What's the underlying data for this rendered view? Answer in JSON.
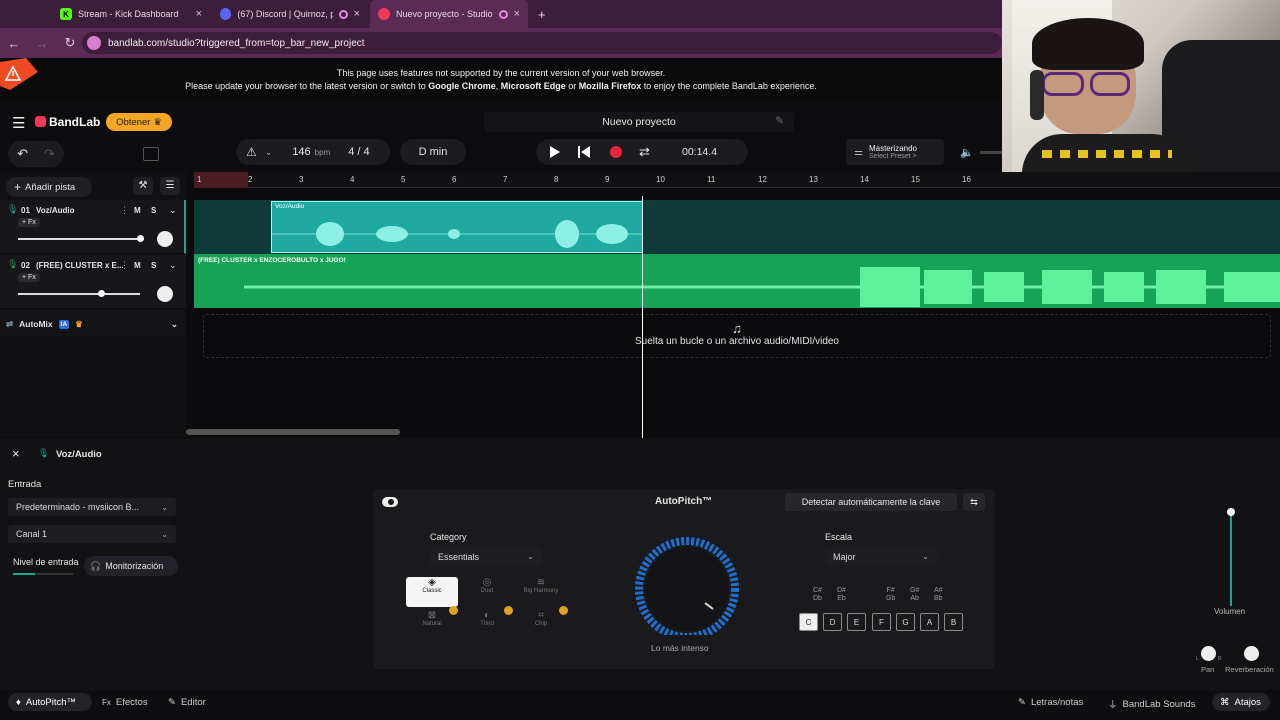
{
  "browser": {
    "tabs": [
      {
        "title": "Stream - Kick Dashboard",
        "favicon": "K",
        "color": "#53fc18"
      },
      {
        "title": "(67) Discord | Quirnoz, p(",
        "favicon": "67",
        "color": "#5865f2"
      },
      {
        "title": "Nuevo proyecto - Studio",
        "favicon": "",
        "color": "#f2385a"
      }
    ],
    "new_tab": "+",
    "url": "bandlab.com/studio?triggered_from=top_bar_new_project"
  },
  "warning": {
    "line1": "This page uses features not supported by the current version of your web browser.",
    "line2_pre": "Please update your browser to the latest version or switch to ",
    "chrome": "Google Chrome",
    "comma": ", ",
    "edge": "Microsoft Edge",
    "or": " or ",
    "firefox": "Mozilla Firefox",
    "line2_post": " to enjoy the complete BandLab experience."
  },
  "header": {
    "logo": "BandLab",
    "get_button": "Obtener",
    "project_name": "Nuevo proyecto"
  },
  "toolbar": {
    "bpm_value": "146",
    "bpm_unit": "bpm",
    "time_sig": "4 / 4",
    "key": "D min",
    "time": "00:14.4",
    "mastering_title": "Masterizando",
    "mastering_sub": "Select Preset >"
  },
  "ruler": {
    "numbers": [
      "1",
      "2",
      "3",
      "4",
      "5",
      "6",
      "7",
      "8",
      "9",
      "10",
      "11",
      "12",
      "13",
      "14",
      "15",
      "16"
    ]
  },
  "tracks_panel": {
    "add_track": "Añadir pista",
    "tracks": [
      {
        "num": "01",
        "name": "Voz/Audio",
        "m": "M",
        "s": "S",
        "fx": "+ Fx"
      },
      {
        "num": "02",
        "name": "(FREE) CLUSTER x E...",
        "m": "M",
        "s": "S",
        "fx": "+ Fx"
      }
    ],
    "automix": "AutoMix",
    "ia": "IA"
  },
  "lanes": {
    "clip1": "Voz/Audio",
    "clip2": "(FREE) CLUSTER x ENZOCEROBULTO x JUGO!",
    "drop_hint": "Suelta un bucle o un archivo audio/MIDI/video"
  },
  "bottom": {
    "track_title": "Voz/Audio",
    "input_label": "Entrada",
    "input_device": "Predeterminado - mvsiicon B...",
    "channel": "Canal 1",
    "level_label": "Nivel de entrada",
    "monitor": "Monitorización",
    "autopitch": {
      "title": "AutoPitch™",
      "detect": "Detectar automáticamente la clave",
      "category_label": "Category",
      "category_value": "Essentials",
      "presets": [
        "Classic",
        "Duet",
        "Big Harmony",
        "Natural",
        "Third",
        "Chip"
      ],
      "dial_label": "Lo más intenso",
      "scale_label": "Escala",
      "scale_value": "Major",
      "sharps": [
        "C#\nDb",
        "D#\nEb",
        "F#\nGb",
        "G#\nAb",
        "A#\nBb"
      ],
      "keys": [
        "C",
        "D",
        "E",
        "F",
        "G",
        "A",
        "B"
      ]
    },
    "volume": "Volumen",
    "pan": "Pan",
    "reverb": "Reverberación",
    "L": "L",
    "R": "R"
  },
  "footer": {
    "autopitch_tab": "AutoPitch™",
    "effects_tab": "Efectos",
    "editor_tab": "Editor",
    "lyrics": "Letras/notas",
    "sounds": "BandLab Sounds",
    "shortcuts": "Atajos"
  }
}
